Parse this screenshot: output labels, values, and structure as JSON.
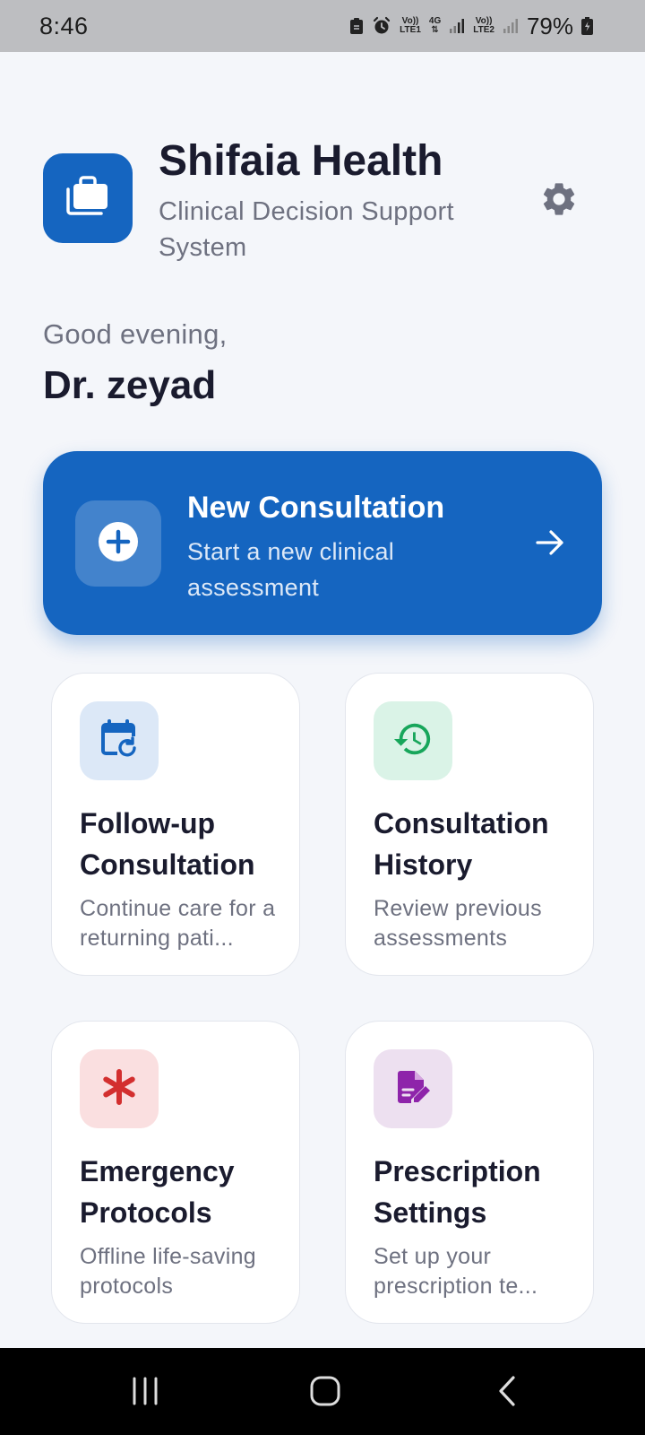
{
  "status_bar": {
    "time": "8:46",
    "net1_top": "Vo))",
    "net1_bottom": "LTE1",
    "net_type": "4G",
    "net2_top": "Vo))",
    "net2_bottom": "LTE2",
    "battery": "79%",
    "icons": [
      "notification-icon",
      "alarm-icon",
      "signal-icon",
      "battery-icon"
    ]
  },
  "header": {
    "title": "Shifaia Health",
    "subtitle": "Clinical Decision Support System",
    "logo_icon": "briefcase-icon",
    "settings_icon": "gear-icon"
  },
  "greeting": {
    "text": "Good evening,",
    "name": "Dr. zeyad"
  },
  "new_consultation": {
    "title": "New Consultation",
    "subtitle": "Start a new clinical assessment",
    "icon": "add-circle-icon",
    "arrow_icon": "arrow-right-icon"
  },
  "cards": [
    {
      "title": "Follow-up Consultation",
      "desc": "Continue care for a returning pati...",
      "icon": "calendar-refresh-icon",
      "icon_bg": "#dce8f7",
      "icon_color": "#1565c0"
    },
    {
      "title": "Consultation History",
      "desc": "Review previous assessments",
      "icon": "history-icon",
      "icon_bg": "#daf3e7",
      "icon_color": "#17a65b"
    },
    {
      "title": "Emergency Protocols",
      "desc": "Offline life-saving protocols",
      "icon": "asterisk-icon",
      "icon_bg": "#fadfe0",
      "icon_color": "#d32f2f"
    },
    {
      "title": "Prescription Settings",
      "desc": "Set up your prescription te...",
      "icon": "edit-document-icon",
      "icon_bg": "#ede0f0",
      "icon_color": "#8e24aa"
    }
  ],
  "colors": {
    "primary": "#1565c0",
    "background": "#f4f6fa",
    "text_dark": "#1a1b2e",
    "text_muted": "#6e7180"
  },
  "nav": {
    "buttons": [
      "recents-icon",
      "home-icon",
      "back-icon"
    ]
  }
}
